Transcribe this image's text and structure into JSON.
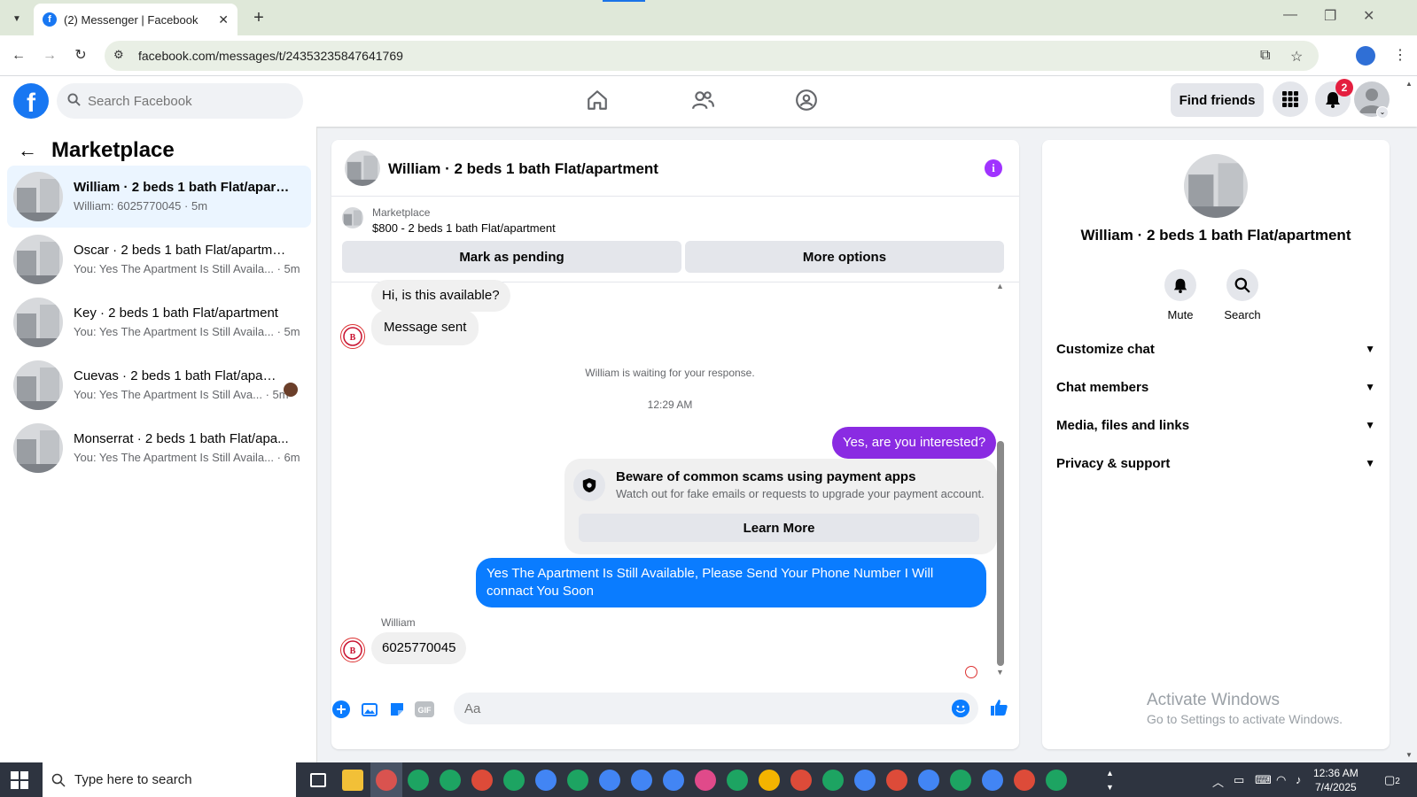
{
  "browser": {
    "tab_title": "(2) Messenger | Facebook",
    "tab_favicon": "f",
    "url": "facebook.com/messages/t/24353235847641769"
  },
  "header": {
    "logo": "f",
    "search_placeholder": "Search Facebook",
    "find_friends": "Find friends",
    "notification_count": "2",
    "nav_icons": [
      "home-icon",
      "friends-icon",
      "groups-icon"
    ]
  },
  "sidebar": {
    "title": "Marketplace",
    "conversations": [
      {
        "name": "William · 2 beds 1 bath Flat/apart...",
        "preview": "William: 6025770045",
        "time": "5m",
        "active": true
      },
      {
        "name": "Oscar · 2 beds 1 bath Flat/apartment",
        "preview": "You: Yes The Apartment Is Still Availa...",
        "time": "5m"
      },
      {
        "name": "Key · 2 beds 1 bath Flat/apartment",
        "preview": "You: Yes The Apartment Is Still Availa...",
        "time": "5m"
      },
      {
        "name": "Cuevas · 2 beds 1 bath Flat/apar...",
        "preview": "You: Yes The Apartment Is Still Ava...",
        "time": "5m"
      },
      {
        "name": "Monserrat · 2 beds 1 bath Flat/apa...",
        "preview": "You: Yes The Apartment Is Still Availa...",
        "time": "6m"
      }
    ]
  },
  "chat": {
    "title": "William · 2 beds 1 bath Flat/apartment",
    "marketplace_label": "Marketplace",
    "listing": "$800 - 2 beds 1 bath Flat/apartment",
    "mark_pending": "Mark as pending",
    "more_options": "More options",
    "msg_in_1": "Hi, is this available?",
    "msg_in_2": "Message sent",
    "waiting_note": "William is waiting for your response.",
    "timestamp": "12:29 AM",
    "msg_out_1": "Yes, are you interested?",
    "scam_title": "Beware of common scams using payment apps",
    "scam_sub": "Watch out for fake emails or requests to upgrade your payment account.",
    "learn_more": "Learn More",
    "msg_out_2": "Yes The Apartment Is Still Available, Please Send Your Phone Number I Will connact You Soon",
    "sender_name": "William",
    "msg_in_3": "6025770045",
    "composer_placeholder": "Aa"
  },
  "info_panel": {
    "name": "William · 2 beds 1 bath Flat/apartment",
    "mute": "Mute",
    "search": "Search",
    "sections": [
      "Customize chat",
      "Chat members",
      "Media, files and links",
      "Privacy & support"
    ]
  },
  "watermark": {
    "title": "Activate Windows",
    "subtitle": "Go to Settings to activate Windows."
  },
  "taskbar": {
    "search_placeholder": "Type here to search",
    "time": "12:36 AM",
    "date": "7/4/2025",
    "notification_count": "2"
  },
  "colors": {
    "fb_blue": "#1877f2",
    "outgoing": "#0a7cff",
    "outgoing_purple": "#8a2be2",
    "info_purple": "#a033ff",
    "badge_red": "#e41e3f"
  }
}
